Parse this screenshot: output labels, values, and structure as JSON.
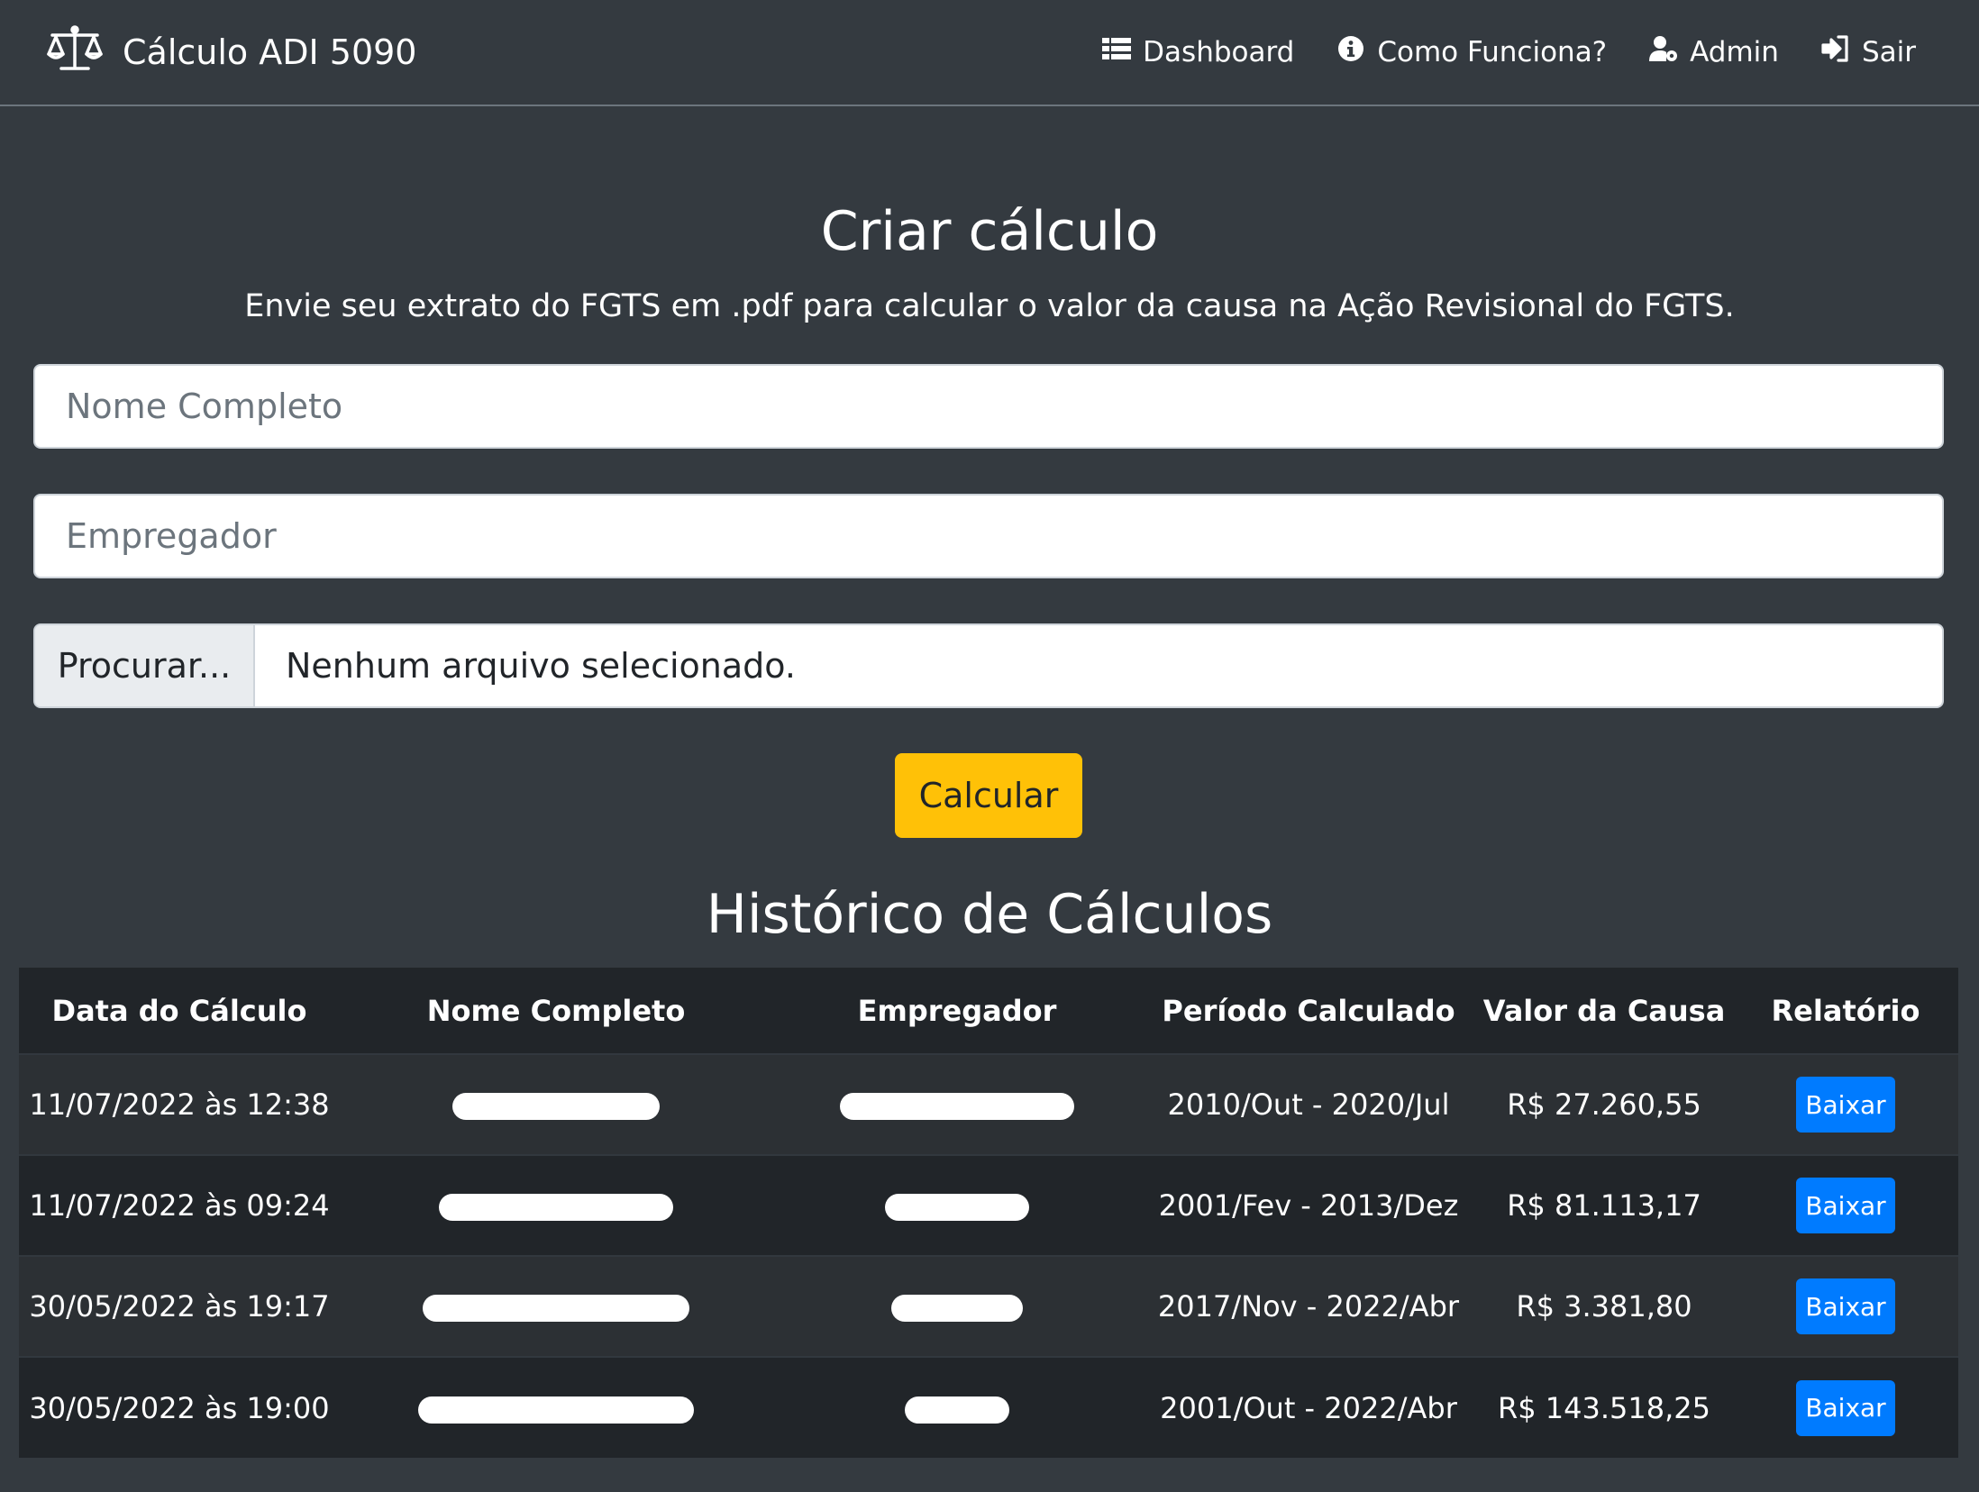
{
  "navbar": {
    "brand": "Cálculo ADI 5090",
    "brand_icon": "balance-scale-icon",
    "items": [
      {
        "label": "Dashboard",
        "icon": "list-icon"
      },
      {
        "label": "Como Funciona?",
        "icon": "info-circle-icon"
      },
      {
        "label": "Admin",
        "icon": "user-cog-icon"
      },
      {
        "label": "Sair",
        "icon": "sign-in-icon"
      }
    ]
  },
  "form": {
    "title": "Criar cálculo",
    "subtitle": "Envie seu extrato do FGTS em .pdf para calcular o valor da causa na Ação Revisional do FGTS.",
    "nome_placeholder": "Nome Completo",
    "nome_value": "",
    "empregador_placeholder": "Empregador",
    "empregador_value": "",
    "file_browse_label": "Procurar...",
    "file_status": "Nenhum arquivo selecionado.",
    "submit_label": "Calcular"
  },
  "history": {
    "title": "Histórico de Cálculos",
    "columns": [
      "Data do Cálculo",
      "Nome Completo",
      "Empregador",
      "Período Calculado",
      "Valor da Causa",
      "Relatório"
    ],
    "rows": [
      {
        "date": "11/07/2022 às 12:38",
        "periodo": "2010/Out - 2020/Jul",
        "valor": "R$ 27.260,55",
        "action": "Baixar"
      },
      {
        "date": "11/07/2022 às 09:24",
        "periodo": "2001/Fev - 2013/Dez",
        "valor": "R$ 81.113,17",
        "action": "Baixar"
      },
      {
        "date": "30/05/2022 às 19:17",
        "periodo": "2017/Nov - 2022/Abr",
        "valor": "R$ 3.381,80",
        "action": "Baixar"
      },
      {
        "date": "30/05/2022 às 19:00",
        "periodo": "2001/Out - 2022/Abr",
        "valor": "R$ 143.518,25",
        "action": "Baixar"
      }
    ]
  },
  "colors": {
    "background": "#343a40",
    "table_header": "#212529",
    "primary": "#007bff",
    "warning": "#ffc107"
  }
}
